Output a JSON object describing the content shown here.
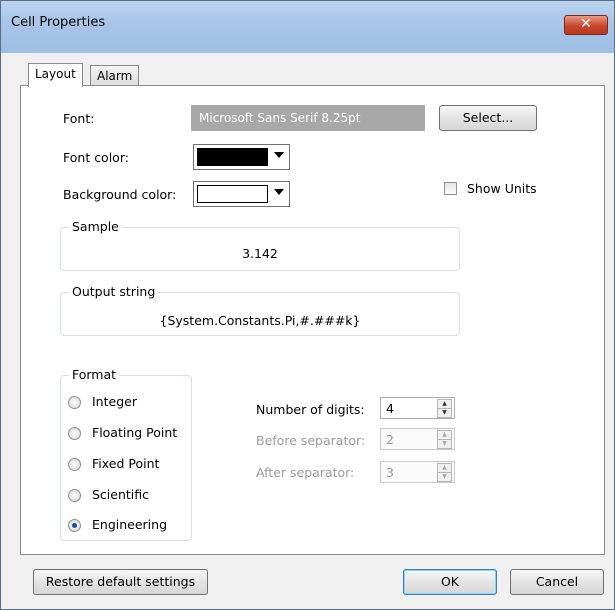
{
  "window": {
    "title": "Cell Properties",
    "close_glyph": "✕"
  },
  "tabs": [
    {
      "label": "Layout"
    },
    {
      "label": "Alarm"
    }
  ],
  "font": {
    "label": "Font:",
    "value": "Microsoft Sans Serif 8.25pt",
    "select_label": "Select..."
  },
  "font_color": {
    "label": "Font color:",
    "value": "#000000"
  },
  "background_color": {
    "label": "Background color:",
    "value": "#ffffff"
  },
  "show_units": {
    "label": "Show Units",
    "checked": false
  },
  "sample": {
    "title": "Sample",
    "value": "3.142"
  },
  "output_string": {
    "title": "Output string",
    "value": "{System.Constants.Pi,#.###k}"
  },
  "format": {
    "title": "Format",
    "options": [
      {
        "label": "Integer",
        "checked": false
      },
      {
        "label": "Floating Point",
        "checked": false
      },
      {
        "label": "Fixed Point",
        "checked": false
      },
      {
        "label": "Scientific",
        "checked": false
      },
      {
        "label": "Engineering",
        "checked": true
      }
    ]
  },
  "digits": {
    "number_label": "Number of digits:",
    "number_value": "4",
    "before_label": "Before separator:",
    "before_value": "2",
    "after_label": "After separator:",
    "after_value": "3"
  },
  "buttons": {
    "restore": "Restore default settings",
    "ok": "OK",
    "cancel": "Cancel"
  },
  "icons": {
    "checkbox": "checkbox-icon",
    "radio": "radio-icon",
    "spin_up": "spin-up-icon",
    "spin_down": "spin-down-icon",
    "dropdown": "chevron-down-icon"
  }
}
